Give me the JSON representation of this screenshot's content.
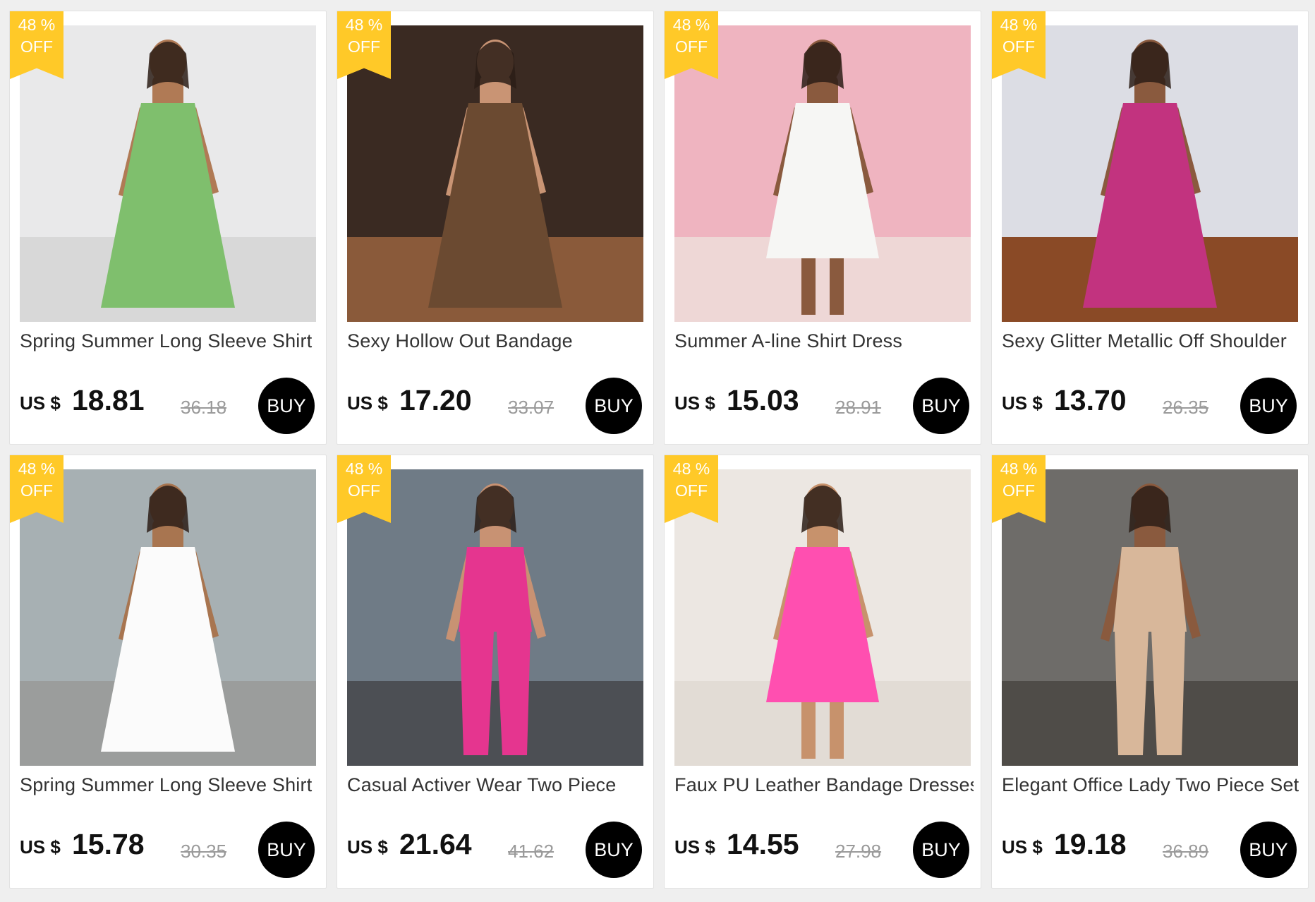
{
  "products": [
    {
      "title": "Spring Summer Long Sleeve Shirt",
      "currency": "US $",
      "price": "18.81",
      "old_price": "36.18",
      "discount_pct": "48 %",
      "discount_off": "OFF",
      "buy_label": "BUY",
      "image_name": "model-green-shirt-dress-photo",
      "colors": {
        "bg": "#e9e9ea",
        "floor": "#d8d8d8",
        "garment": "#7fbf6d",
        "skin": "#b07a55"
      }
    },
    {
      "title": "Sexy Hollow Out Bandage",
      "currency": "US $",
      "price": "17.20",
      "old_price": "33.07",
      "discount_pct": "48 %",
      "discount_off": "OFF",
      "buy_label": "BUY",
      "image_name": "model-brown-bandage-dress-photo",
      "colors": {
        "bg": "#3a2a22",
        "floor": "#8a5a3a",
        "garment": "#6b4a31",
        "skin": "#c99474"
      }
    },
    {
      "title": "Summer A-line Shirt Dress",
      "currency": "US $",
      "price": "15.03",
      "old_price": "28.91",
      "discount_pct": "48 %",
      "discount_off": "OFF",
      "buy_label": "BUY",
      "image_name": "model-white-shirt-dress-photo",
      "colors": {
        "bg": "#efb4c0",
        "floor": "#eed7d6",
        "garment": "#f6f6f4",
        "skin": "#8a5a3e"
      }
    },
    {
      "title": "Sexy Glitter Metallic Off Shoulder",
      "currency": "US $",
      "price": "13.70",
      "old_price": "26.35",
      "discount_pct": "48 %",
      "discount_off": "OFF",
      "buy_label": "BUY",
      "image_name": "model-pink-metallic-dress-photo",
      "colors": {
        "bg": "#dcdde4",
        "floor": "#8a4a26",
        "garment": "#c2337f",
        "skin": "#8a5a3e"
      }
    },
    {
      "title": "Spring Summer Long Sleeve Shirt",
      "currency": "US $",
      "price": "15.78",
      "old_price": "30.35",
      "discount_pct": "48 %",
      "discount_off": "OFF",
      "buy_label": "BUY",
      "image_name": "model-white-long-shirt-dress-photo",
      "colors": {
        "bg": "#a7b0b3",
        "floor": "#9b9d9c",
        "garment": "#fbfbfb",
        "skin": "#a87550"
      }
    },
    {
      "title": "Casual Activer Wear Two Piece",
      "currency": "US $",
      "price": "21.64",
      "old_price": "41.62",
      "discount_pct": "48 %",
      "discount_off": "OFF",
      "buy_label": "BUY",
      "image_name": "model-pink-tracksuit-photo",
      "colors": {
        "bg": "#6f7b86",
        "floor": "#4c4f54",
        "garment": "#e5358f",
        "skin": "#c89273"
      }
    },
    {
      "title": "Faux PU Leather Bandage Dresses",
      "currency": "US $",
      "price": "14.55",
      "old_price": "27.98",
      "discount_pct": "48 %",
      "discount_off": "OFF",
      "buy_label": "BUY",
      "image_name": "model-pink-leather-dress-photo",
      "colors": {
        "bg": "#ece7e2",
        "floor": "#e2dcd5",
        "garment": "#ff4fb0",
        "skin": "#c7926c"
      }
    },
    {
      "title": "Elegant Office Lady Two Piece Set",
      "currency": "US $",
      "price": "19.18",
      "old_price": "36.89",
      "discount_pct": "48 %",
      "discount_off": "OFF",
      "buy_label": "BUY",
      "image_name": "model-beige-two-piece-photo",
      "colors": {
        "bg": "#6e6c69",
        "floor": "#4f4c48",
        "garment": "#d8b79a",
        "skin": "#8a5a3e"
      }
    }
  ]
}
